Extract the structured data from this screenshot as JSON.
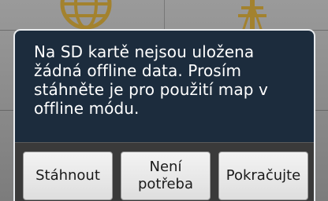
{
  "dialog": {
    "message": "Na SD kartě nejsou uložena žádná offline data. Prosím stáhněte je pro použití map v offline módu.",
    "buttons": {
      "download": "Stáhnout",
      "not_needed": "Není potřeba",
      "continue": "Pokračujte"
    }
  },
  "icons": {
    "background_left": "globe-icon",
    "background_right": "tower-icon"
  },
  "colors": {
    "dialog_background": "#1c2c3d",
    "dialog_border": "#e9ecef",
    "button_bar": "#3a3a3a",
    "button_face": "#e8e8e8",
    "message_text": "#ffffff"
  }
}
